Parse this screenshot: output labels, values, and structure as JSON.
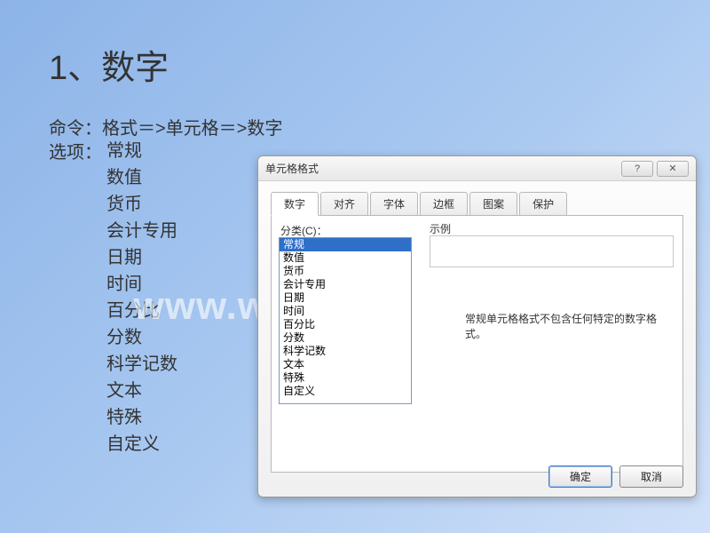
{
  "slide": {
    "title": "1、数字",
    "command": "命令：格式＝>单元格＝>数字",
    "options_label": "选项：",
    "options": [
      "常规",
      "数值",
      "货币",
      "会计专用",
      "日期",
      "时间",
      "百分比",
      "分数",
      "科学记数",
      "文本",
      "特殊",
      "自定义"
    ]
  },
  "watermark": "www.weizhuannet.com",
  "dialog": {
    "title": "单元格格式",
    "help": "?",
    "close": "✕",
    "tabs": [
      "数字",
      "对齐",
      "字体",
      "边框",
      "图案",
      "保护"
    ],
    "category_label": "分类(C)：",
    "categories": [
      "常规",
      "数值",
      "货币",
      "会计专用",
      "日期",
      "时间",
      "百分比",
      "分数",
      "科学记数",
      "文本",
      "特殊",
      "自定义"
    ],
    "selected_index": 0,
    "sample_label": "示例",
    "description": "常规单元格格式不包含任何特定的数字格式。",
    "ok": "确定",
    "cancel": "取消"
  }
}
